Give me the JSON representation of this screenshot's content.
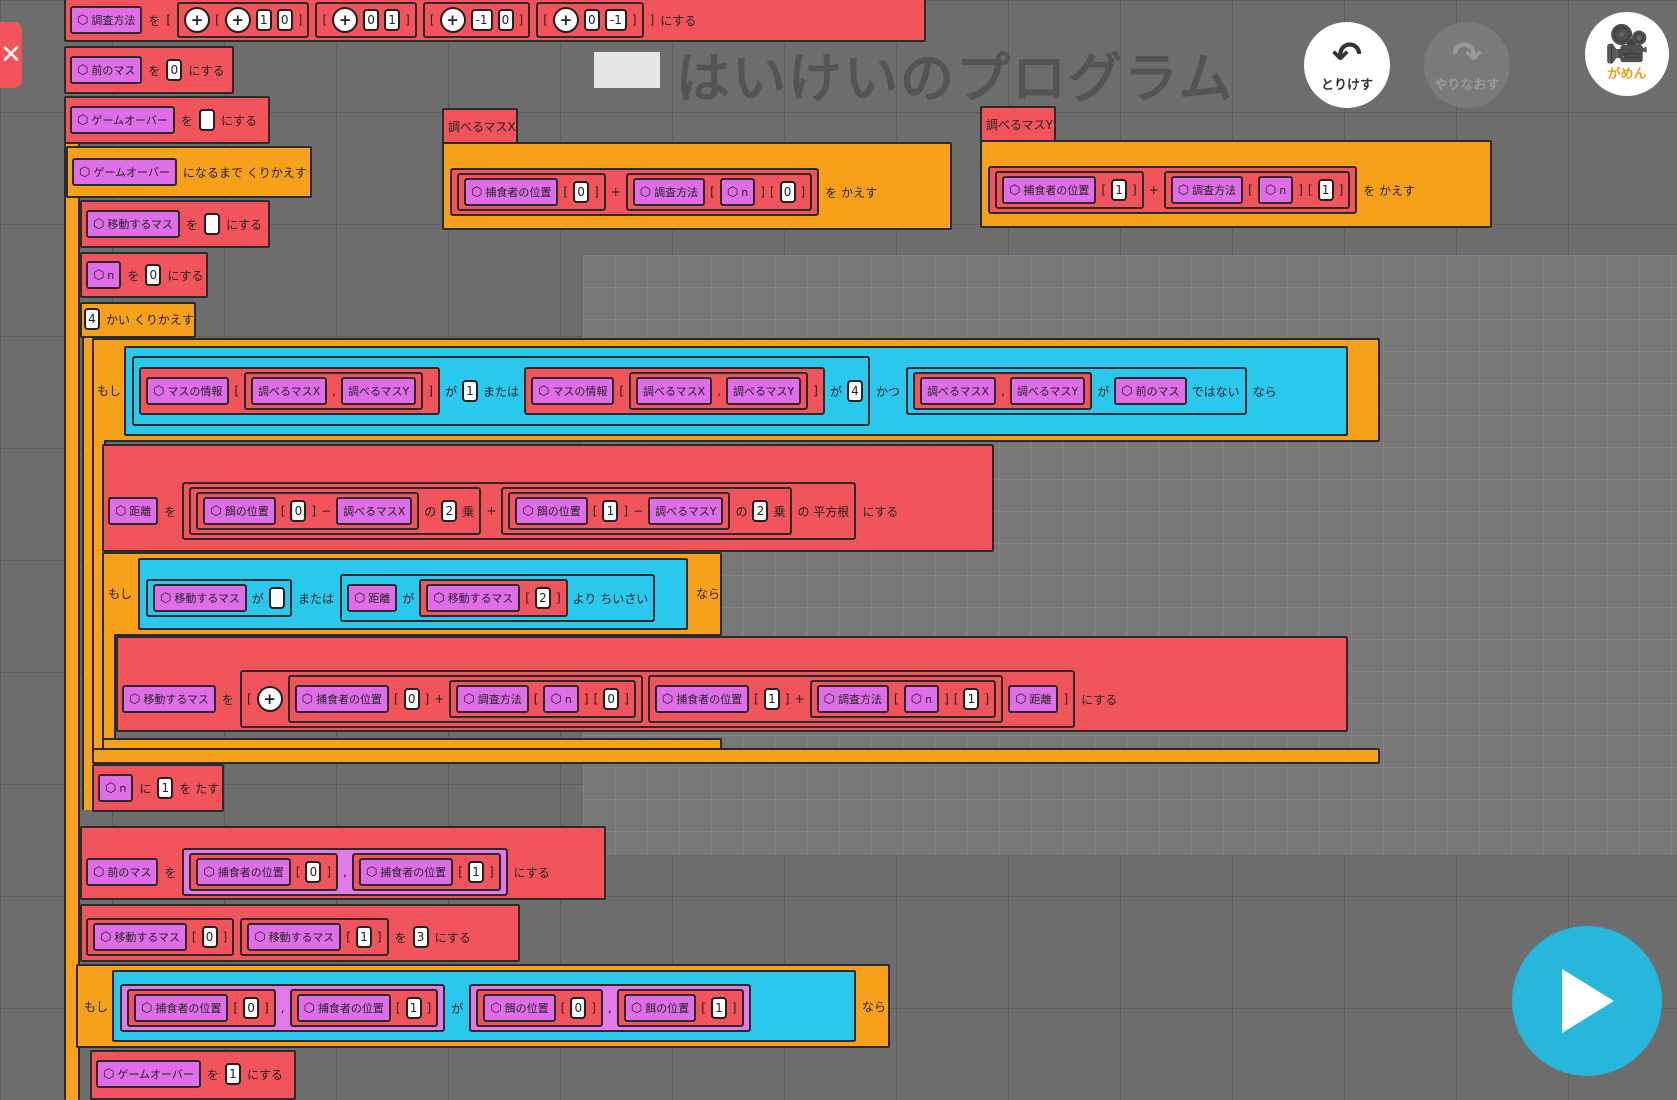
{
  "header": {
    "title": "はいけいのプログラム",
    "undo_label": "とりけす",
    "redo_label": "やりなおす",
    "screen_label": "がめん"
  },
  "vars": {
    "survey": "調査方法",
    "prev": "前のマス",
    "gameover": "ゲームオーバー",
    "move": "移動するマス",
    "n": "n",
    "checkX": "調べるマスX",
    "checkY": "調べるマスY",
    "predator": "捕食者の位置",
    "bait": "餌の位置",
    "info": "マスの情報",
    "dist": "距離"
  },
  "words": {
    "wo": "を",
    "ni_suru": "にする",
    "until": "になるまで くりかえす",
    "times": "かい くりかえす",
    "moshi": "もし",
    "ga": "が",
    "mataha": "または",
    "katsu": "かつ",
    "dewanai": "ではない",
    "nara": "なら",
    "no": "の",
    "jou": "乗",
    "sqrt": "の 平方根",
    "smaller": "より ちいさい",
    "ni": "に",
    "wo_tasu": "を たす",
    "wo_kaesu": "を かえす",
    "plus": "+",
    "minus": "−",
    "comma": ",",
    "lb": "[",
    "rb": "]"
  },
  "nums": {
    "zero": "0",
    "one": "1",
    "two": "2",
    "three": "3",
    "four": "4",
    "neg1": "-1"
  },
  "play_label": "play"
}
